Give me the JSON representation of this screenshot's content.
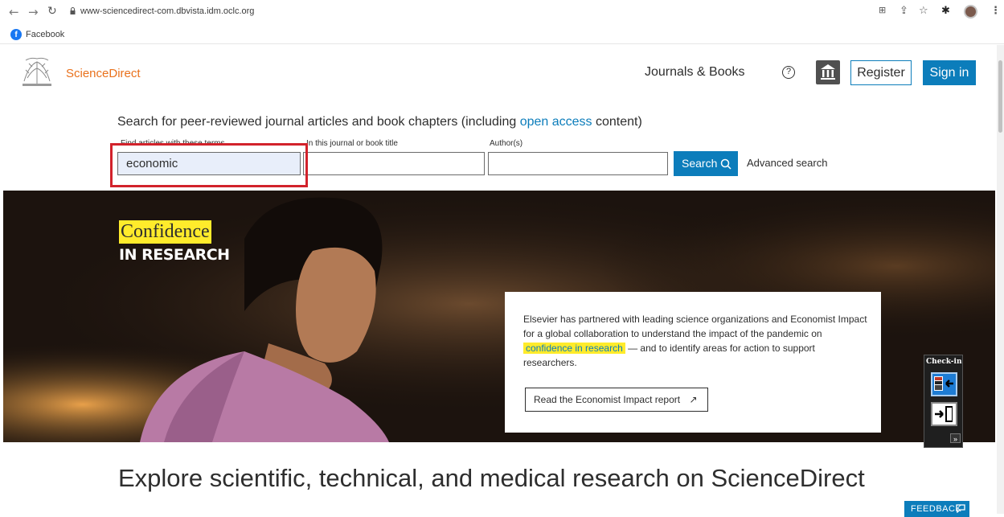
{
  "browser": {
    "url": "www-sciencedirect-com.dbvista.idm.oclc.org",
    "bookmark_label": "Facebook"
  },
  "header": {
    "brand": "ScienceDirect",
    "journals_books": "Journals & Books",
    "help": "?",
    "register": "Register",
    "sign_in": "Sign in"
  },
  "search": {
    "intro_pre": "Search for peer-reviewed journal articles and book chapters (including ",
    "intro_link": "open access",
    "intro_post": " content)",
    "terms_label": "Find articles with these terms",
    "terms_value": "economic",
    "journal_label": "In this journal or book title",
    "journal_value": "",
    "author_label": "Author(s)",
    "author_value": "",
    "button_label": "Search",
    "advanced": "Advanced search"
  },
  "hero": {
    "confidence": "Confidence",
    "in_research": "IN RESEARCH",
    "card_text_1": "Elsevier has partnered with leading science organizations and Economist Impact for a global collaboration to understand the impact of the pandemic on ",
    "card_highlight": "confidence in research",
    "card_text_2": " — and to identify areas for action to support researchers.",
    "report_button": "Read the Economist Impact report",
    "report_arrow": "↗"
  },
  "checkin": {
    "title": "Check-in",
    "more": "»"
  },
  "bottom": {
    "explore_heading": "Explore scientific, technical, and medical research on ScienceDirect",
    "feedback": "FEEDBACK"
  }
}
